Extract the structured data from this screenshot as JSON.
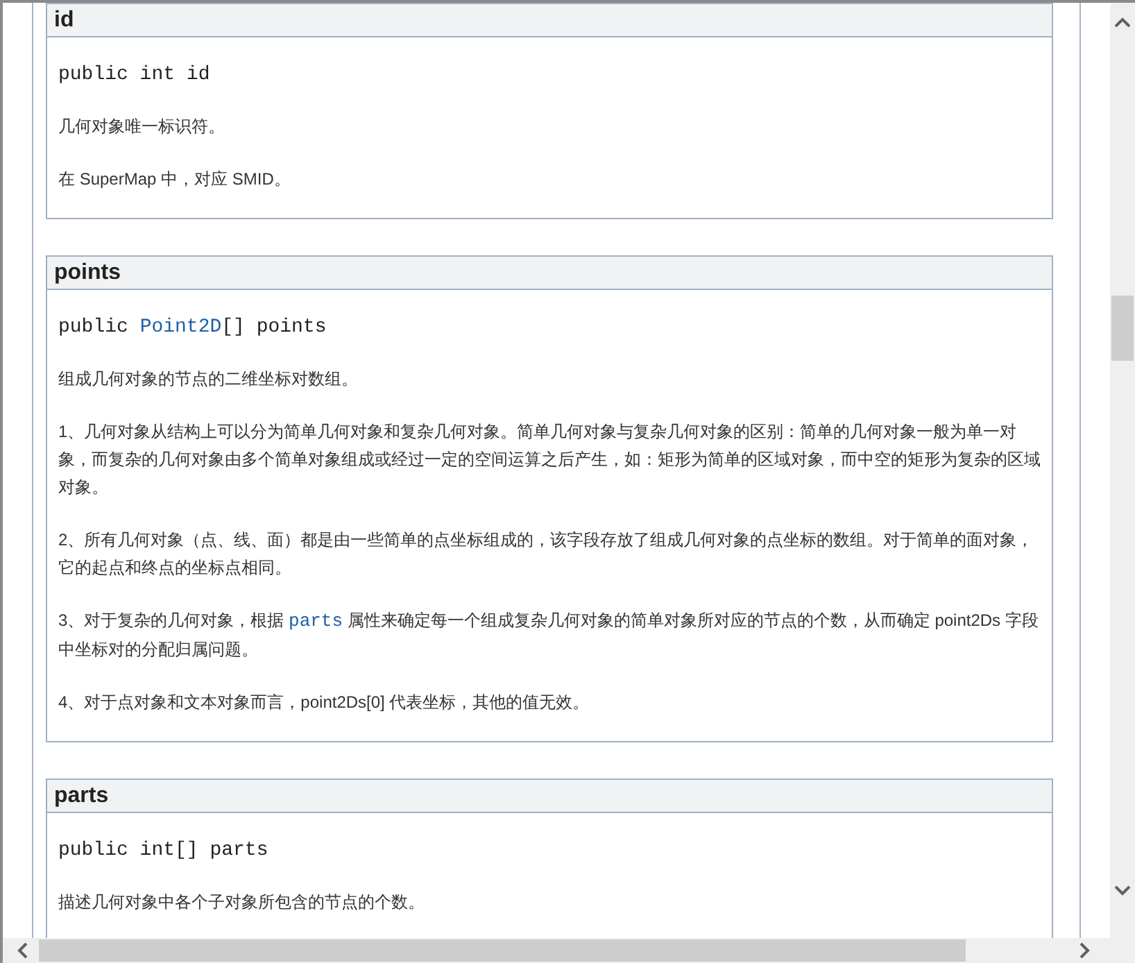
{
  "members": [
    {
      "name": "id",
      "signature": [
        {
          "text": "public int id",
          "kind": "plain"
        }
      ],
      "paragraphs": [
        [
          {
            "text": "几何对象唯一标识符。",
            "kind": "text"
          }
        ],
        [
          {
            "text": "在 SuperMap 中，对应 SMID。",
            "kind": "text"
          }
        ]
      ]
    },
    {
      "name": "points",
      "signature": [
        {
          "text": "public ",
          "kind": "plain"
        },
        {
          "text": "Point2D",
          "kind": "link"
        },
        {
          "text": "[] points",
          "kind": "plain"
        }
      ],
      "paragraphs": [
        [
          {
            "text": "组成几何对象的节点的二维坐标对数组。",
            "kind": "text"
          }
        ],
        [
          {
            "text": "1、几何对象从结构上可以分为简单几何对象和复杂几何对象。简单几何对象与复杂几何对象的区别：简单的几何对象一般为单一对象，而复杂的几何对象由多个简单对象组成或经过一定的空间运算之后产生，如：矩形为简单的区域对象，而中空的矩形为复杂的区域对象。",
            "kind": "text"
          }
        ],
        [
          {
            "text": "2、所有几何对象（点、线、面）都是由一些简单的点坐标组成的，该字段存放了组成几何对象的点坐标的数组。对于简单的面对象，它的起点和终点的坐标点相同。",
            "kind": "text"
          }
        ],
        [
          {
            "text": "3、对于复杂的几何对象，根据 ",
            "kind": "text"
          },
          {
            "text": "parts",
            "kind": "link"
          },
          {
            "text": " 属性来确定每一个组成复杂几何对象的简单对象所对应的节点的个数，从而确定 point2Ds 字段中坐标对的分配归属问题。",
            "kind": "text"
          }
        ],
        [
          {
            "text": "4、对于点对象和文本对象而言，point2Ds[0] 代表坐标，其他的值无效。",
            "kind": "text"
          }
        ]
      ]
    },
    {
      "name": "parts",
      "signature": [
        {
          "text": "public int[] parts",
          "kind": "plain"
        }
      ],
      "paragraphs": [
        [
          {
            "text": "描述几何对象中各个子对象所包含的节点的个数。",
            "kind": "text"
          }
        ]
      ]
    }
  ]
}
